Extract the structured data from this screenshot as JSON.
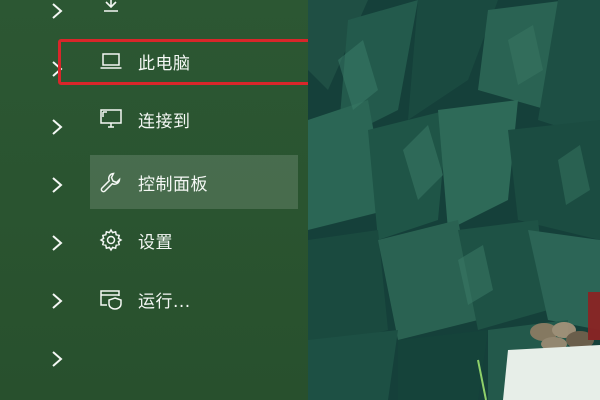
{
  "menu": {
    "items": [
      {
        "label": "此电脑",
        "icon": "laptop-icon"
      },
      {
        "label": "连接到",
        "icon": "monitor-connect-icon"
      },
      {
        "label": "控制面板",
        "icon": "wrench-icon"
      },
      {
        "label": "设置",
        "icon": "gear-icon"
      },
      {
        "label": "运行...",
        "icon": "run-icon"
      }
    ]
  },
  "colors": {
    "menu_background": "#2b5532",
    "highlight_border": "#d9262a",
    "hover_background": "rgba(255,255,255,0.14)",
    "text": "#f4f7f4"
  }
}
